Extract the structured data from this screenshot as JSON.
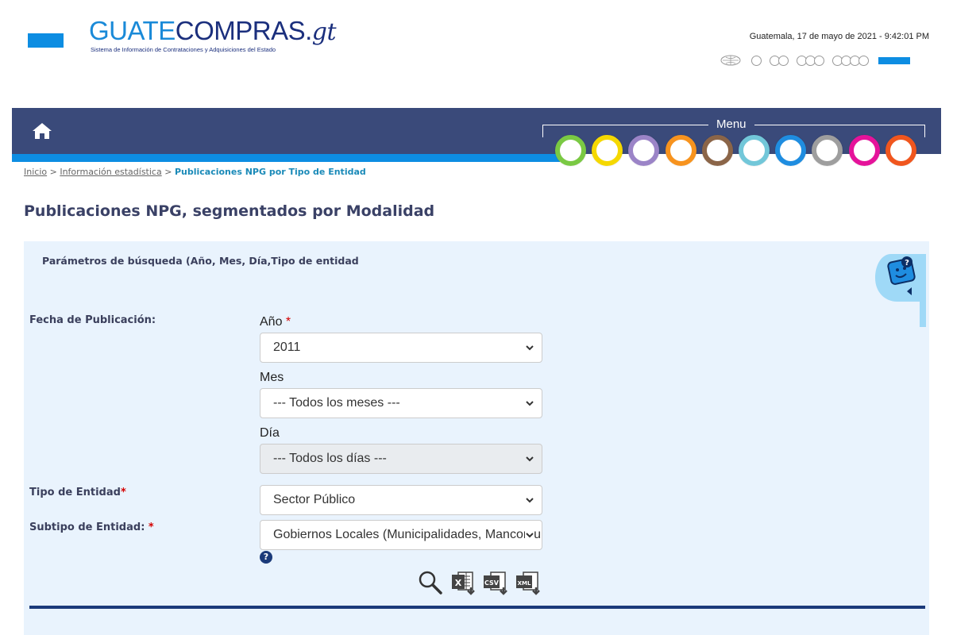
{
  "header": {
    "logo": {
      "part1": "GUATE",
      "part2": "COMPRAS.",
      "part3": "gt",
      "subtitle": "Sistema de Información de Contrataciones y Adquisiciones del Estado"
    },
    "datetime": "Guatemala, 17 de mayo de 2021 - 9:42:01 PM"
  },
  "nav": {
    "menu_label": "Menu",
    "menu_colors": [
      "#7ac943",
      "#f5d800",
      "#9b84c7",
      "#f7931e",
      "#8b6548",
      "#72c7d9",
      "#1f8de0",
      "#9e9e9e",
      "#e5139a",
      "#f0561e"
    ]
  },
  "breadcrumb": {
    "home": "Inicio",
    "sep1": ">",
    "section": "Información estadística",
    "sep2": ">",
    "current": "Publicaciones NPG por Tipo de Entidad"
  },
  "page_title": "Publicaciones NPG, segmentados por Modalidad",
  "form": {
    "panel_title": "Parámetros de búsqueda (Año, Mes, Día,Tipo de entidad",
    "fecha_label": "Fecha de Publicación:",
    "anio_label": "Año",
    "anio_value": "2011",
    "mes_label": "Mes",
    "mes_value": "--- Todos los meses ---",
    "dia_label": "Día",
    "dia_value": "--- Todos los días ---",
    "tipo_label": "Tipo de Entidad",
    "tipo_value": "Sector Público",
    "subtipo_label": "Subtipo de Entidad: ",
    "subtipo_value": "Gobiernos Locales (Municipalidades, Mancomunidades, etc.)",
    "required_mark": "*",
    "help_mark": "?"
  },
  "tools": {
    "excel_text": "X",
    "csv_text": "CSV",
    "xml_text": "XML"
  },
  "colors": {
    "accent": "#0d8de2",
    "navbar": "#3a4a7a",
    "panel": "#e9f3fd",
    "dark": "#1b3a7a"
  }
}
